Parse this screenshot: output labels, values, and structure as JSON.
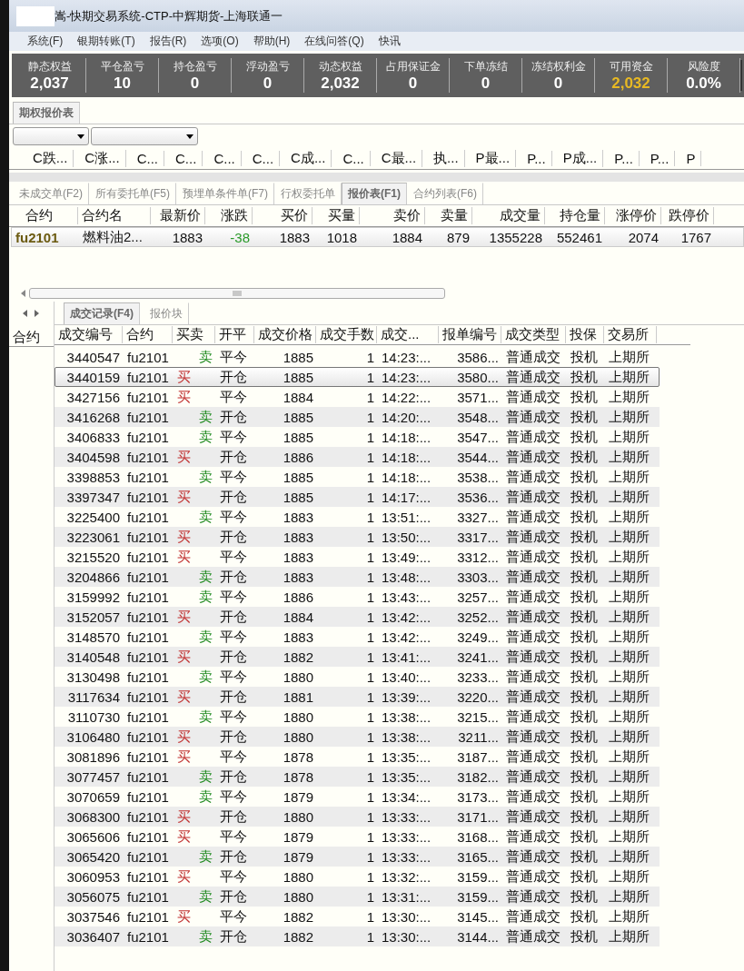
{
  "window": {
    "title": "嵩-快期交易系统-CTP-中辉期货-上海联通一"
  },
  "menu": [
    "系统(F)",
    "银期转账(T)",
    "报告(R)",
    "选项(O)",
    "帮助(H)",
    "在线问答(Q)",
    "快讯"
  ],
  "account": [
    {
      "label": "静态权益",
      "value": "2,037",
      "highlight": false
    },
    {
      "label": "平仓盈亏",
      "value": "10",
      "highlight": false
    },
    {
      "label": "持仓盈亏",
      "value": "0",
      "highlight": false
    },
    {
      "label": "浮动盈亏",
      "value": "0",
      "highlight": false
    },
    {
      "label": "动态权益",
      "value": "2,032",
      "highlight": false
    },
    {
      "label": "占用保证金",
      "value": "0",
      "highlight": false
    },
    {
      "label": "下单冻结",
      "value": "0",
      "highlight": false
    },
    {
      "label": "冻结权利金",
      "value": "0",
      "highlight": false
    },
    {
      "label": "可用资金",
      "value": "2,032",
      "highlight": true
    },
    {
      "label": "风险度",
      "value": "0.0%",
      "highlight": false
    }
  ],
  "option_panel": {
    "tab": "期权报价表",
    "columns": [
      "C跌...",
      "C涨...",
      "C...",
      "C...",
      "C...",
      "C...",
      "C成...",
      "C...",
      "C最...",
      "执...",
      "P最...",
      "P...",
      "P成...",
      "P...",
      "P...",
      "P"
    ]
  },
  "order_tabs": [
    {
      "label": "未成交单(F2)",
      "selected": false
    },
    {
      "label": "所有委托单(F5)",
      "selected": false
    },
    {
      "label": "预埋单条件单(F7)",
      "selected": false
    },
    {
      "label": "行权委托单",
      "selected": false
    },
    {
      "label": "报价表(F1)",
      "selected": true
    },
    {
      "label": "合约列表(F6)",
      "selected": false
    }
  ],
  "quote_table": {
    "columns": [
      "合约",
      "合约名",
      "最新价",
      "涨跌",
      "买价",
      "买量",
      "卖价",
      "卖量",
      "成交量",
      "持仓量",
      "涨停价",
      "跌停价"
    ],
    "rows": [
      {
        "cells": [
          "fu2101",
          "燃料油2...",
          "1883",
          "-38",
          "1883",
          "1018",
          "1884",
          "879",
          "1355228",
          "552461",
          "2074",
          "1767"
        ],
        "color": "#2a9a2a"
      }
    ]
  },
  "trade_tabs": [
    {
      "label": "成交记录(F4)",
      "selected": true
    },
    {
      "label": "报价块",
      "selected": false
    }
  ],
  "trade_table": {
    "side_column": "合约",
    "columns": [
      "成交编号",
      "合约",
      "买卖",
      "开平",
      "成交价格",
      "成交手数",
      "成交...",
      "报单编号",
      "成交类型",
      "投保",
      "交易所"
    ],
    "rows": [
      {
        "id": "3440547",
        "contract": "fu2101",
        "side": "卖",
        "kind": "sell",
        "offset": "平今",
        "price": "1885",
        "qty": "1",
        "time": "14:23:...",
        "order": "3586...",
        "type": "普通成交",
        "hedge": "投机",
        "exchange": "上期所",
        "selected": false
      },
      {
        "id": "3440159",
        "contract": "fu2101",
        "side": "买",
        "kind": "buy",
        "offset": "开仓",
        "price": "1885",
        "qty": "1",
        "time": "14:23:...",
        "order": "3580...",
        "type": "普通成交",
        "hedge": "投机",
        "exchange": "上期所",
        "selected": true
      },
      {
        "id": "3427156",
        "contract": "fu2101",
        "side": "买",
        "kind": "buy",
        "offset": "平今",
        "price": "1884",
        "qty": "1",
        "time": "14:22:...",
        "order": "3571...",
        "type": "普通成交",
        "hedge": "投机",
        "exchange": "上期所",
        "selected": false
      },
      {
        "id": "3416268",
        "contract": "fu2101",
        "side": "卖",
        "kind": "sell",
        "offset": "开仓",
        "price": "1885",
        "qty": "1",
        "time": "14:20:...",
        "order": "3548...",
        "type": "普通成交",
        "hedge": "投机",
        "exchange": "上期所",
        "selected": false
      },
      {
        "id": "3406833",
        "contract": "fu2101",
        "side": "卖",
        "kind": "sell",
        "offset": "平今",
        "price": "1885",
        "qty": "1",
        "time": "14:18:...",
        "order": "3547...",
        "type": "普通成交",
        "hedge": "投机",
        "exchange": "上期所",
        "selected": false
      },
      {
        "id": "3404598",
        "contract": "fu2101",
        "side": "买",
        "kind": "buy",
        "offset": "开仓",
        "price": "1886",
        "qty": "1",
        "time": "14:18:...",
        "order": "3544...",
        "type": "普通成交",
        "hedge": "投机",
        "exchange": "上期所",
        "selected": false
      },
      {
        "id": "3398853",
        "contract": "fu2101",
        "side": "卖",
        "kind": "sell",
        "offset": "平今",
        "price": "1885",
        "qty": "1",
        "time": "14:18:...",
        "order": "3538...",
        "type": "普通成交",
        "hedge": "投机",
        "exchange": "上期所",
        "selected": false
      },
      {
        "id": "3397347",
        "contract": "fu2101",
        "side": "买",
        "kind": "buy",
        "offset": "开仓",
        "price": "1885",
        "qty": "1",
        "time": "14:17:...",
        "order": "3536...",
        "type": "普通成交",
        "hedge": "投机",
        "exchange": "上期所",
        "selected": false
      },
      {
        "id": "3225400",
        "contract": "fu2101",
        "side": "卖",
        "kind": "sell",
        "offset": "平今",
        "price": "1883",
        "qty": "1",
        "time": "13:51:...",
        "order": "3327...",
        "type": "普通成交",
        "hedge": "投机",
        "exchange": "上期所",
        "selected": false
      },
      {
        "id": "3223061",
        "contract": "fu2101",
        "side": "买",
        "kind": "buy",
        "offset": "开仓",
        "price": "1883",
        "qty": "1",
        "time": "13:50:...",
        "order": "3317...",
        "type": "普通成交",
        "hedge": "投机",
        "exchange": "上期所",
        "selected": false
      },
      {
        "id": "3215520",
        "contract": "fu2101",
        "side": "买",
        "kind": "buy",
        "offset": "平今",
        "price": "1883",
        "qty": "1",
        "time": "13:49:...",
        "order": "3312...",
        "type": "普通成交",
        "hedge": "投机",
        "exchange": "上期所",
        "selected": false
      },
      {
        "id": "3204866",
        "contract": "fu2101",
        "side": "卖",
        "kind": "sell",
        "offset": "开仓",
        "price": "1883",
        "qty": "1",
        "time": "13:48:...",
        "order": "3303...",
        "type": "普通成交",
        "hedge": "投机",
        "exchange": "上期所",
        "selected": false
      },
      {
        "id": "3159992",
        "contract": "fu2101",
        "side": "卖",
        "kind": "sell",
        "offset": "平今",
        "price": "1886",
        "qty": "1",
        "time": "13:43:...",
        "order": "3257...",
        "type": "普通成交",
        "hedge": "投机",
        "exchange": "上期所",
        "selected": false
      },
      {
        "id": "3152057",
        "contract": "fu2101",
        "side": "买",
        "kind": "buy",
        "offset": "开仓",
        "price": "1884",
        "qty": "1",
        "time": "13:42:...",
        "order": "3252...",
        "type": "普通成交",
        "hedge": "投机",
        "exchange": "上期所",
        "selected": false
      },
      {
        "id": "3148570",
        "contract": "fu2101",
        "side": "卖",
        "kind": "sell",
        "offset": "平今",
        "price": "1883",
        "qty": "1",
        "time": "13:42:...",
        "order": "3249...",
        "type": "普通成交",
        "hedge": "投机",
        "exchange": "上期所",
        "selected": false
      },
      {
        "id": "3140548",
        "contract": "fu2101",
        "side": "买",
        "kind": "buy",
        "offset": "开仓",
        "price": "1882",
        "qty": "1",
        "time": "13:41:...",
        "order": "3241...",
        "type": "普通成交",
        "hedge": "投机",
        "exchange": "上期所",
        "selected": false
      },
      {
        "id": "3130498",
        "contract": "fu2101",
        "side": "卖",
        "kind": "sell",
        "offset": "平今",
        "price": "1880",
        "qty": "1",
        "time": "13:40:...",
        "order": "3233...",
        "type": "普通成交",
        "hedge": "投机",
        "exchange": "上期所",
        "selected": false
      },
      {
        "id": "3117634",
        "contract": "fu2101",
        "side": "买",
        "kind": "buy",
        "offset": "开仓",
        "price": "1881",
        "qty": "1",
        "time": "13:39:...",
        "order": "3220...",
        "type": "普通成交",
        "hedge": "投机",
        "exchange": "上期所",
        "selected": false
      },
      {
        "id": "3110730",
        "contract": "fu2101",
        "side": "卖",
        "kind": "sell",
        "offset": "平今",
        "price": "1880",
        "qty": "1",
        "time": "13:38:...",
        "order": "3215...",
        "type": "普通成交",
        "hedge": "投机",
        "exchange": "上期所",
        "selected": false
      },
      {
        "id": "3106480",
        "contract": "fu2101",
        "side": "买",
        "kind": "buy",
        "offset": "开仓",
        "price": "1880",
        "qty": "1",
        "time": "13:38:...",
        "order": "3211...",
        "type": "普通成交",
        "hedge": "投机",
        "exchange": "上期所",
        "selected": false
      },
      {
        "id": "3081896",
        "contract": "fu2101",
        "side": "买",
        "kind": "buy",
        "offset": "平今",
        "price": "1878",
        "qty": "1",
        "time": "13:35:...",
        "order": "3187...",
        "type": "普通成交",
        "hedge": "投机",
        "exchange": "上期所",
        "selected": false
      },
      {
        "id": "3077457",
        "contract": "fu2101",
        "side": "卖",
        "kind": "sell",
        "offset": "开仓",
        "price": "1878",
        "qty": "1",
        "time": "13:35:...",
        "order": "3182...",
        "type": "普通成交",
        "hedge": "投机",
        "exchange": "上期所",
        "selected": false
      },
      {
        "id": "3070659",
        "contract": "fu2101",
        "side": "卖",
        "kind": "sell",
        "offset": "平今",
        "price": "1879",
        "qty": "1",
        "time": "13:34:...",
        "order": "3173...",
        "type": "普通成交",
        "hedge": "投机",
        "exchange": "上期所",
        "selected": false
      },
      {
        "id": "3068300",
        "contract": "fu2101",
        "side": "买",
        "kind": "buy",
        "offset": "开仓",
        "price": "1880",
        "qty": "1",
        "time": "13:33:...",
        "order": "3171...",
        "type": "普通成交",
        "hedge": "投机",
        "exchange": "上期所",
        "selected": false
      },
      {
        "id": "3065606",
        "contract": "fu2101",
        "side": "买",
        "kind": "buy",
        "offset": "平今",
        "price": "1879",
        "qty": "1",
        "time": "13:33:...",
        "order": "3168...",
        "type": "普通成交",
        "hedge": "投机",
        "exchange": "上期所",
        "selected": false
      },
      {
        "id": "3065420",
        "contract": "fu2101",
        "side": "卖",
        "kind": "sell",
        "offset": "开仓",
        "price": "1879",
        "qty": "1",
        "time": "13:33:...",
        "order": "3165...",
        "type": "普通成交",
        "hedge": "投机",
        "exchange": "上期所",
        "selected": false
      },
      {
        "id": "3060953",
        "contract": "fu2101",
        "side": "买",
        "kind": "buy",
        "offset": "平今",
        "price": "1880",
        "qty": "1",
        "time": "13:32:...",
        "order": "3159...",
        "type": "普通成交",
        "hedge": "投机",
        "exchange": "上期所",
        "selected": false
      },
      {
        "id": "3056075",
        "contract": "fu2101",
        "side": "卖",
        "kind": "sell",
        "offset": "开仓",
        "price": "1880",
        "qty": "1",
        "time": "13:31:...",
        "order": "3159...",
        "type": "普通成交",
        "hedge": "投机",
        "exchange": "上期所",
        "selected": false
      },
      {
        "id": "3037546",
        "contract": "fu2101",
        "side": "买",
        "kind": "buy",
        "offset": "平今",
        "price": "1882",
        "qty": "1",
        "time": "13:30:...",
        "order": "3145...",
        "type": "普通成交",
        "hedge": "投机",
        "exchange": "上期所",
        "selected": false
      },
      {
        "id": "3036407",
        "contract": "fu2101",
        "side": "卖",
        "kind": "sell",
        "offset": "开仓",
        "price": "1882",
        "qty": "1",
        "time": "13:30:...",
        "order": "3144...",
        "type": "普通成交",
        "hedge": "投机",
        "exchange": "上期所",
        "selected": false
      }
    ]
  }
}
